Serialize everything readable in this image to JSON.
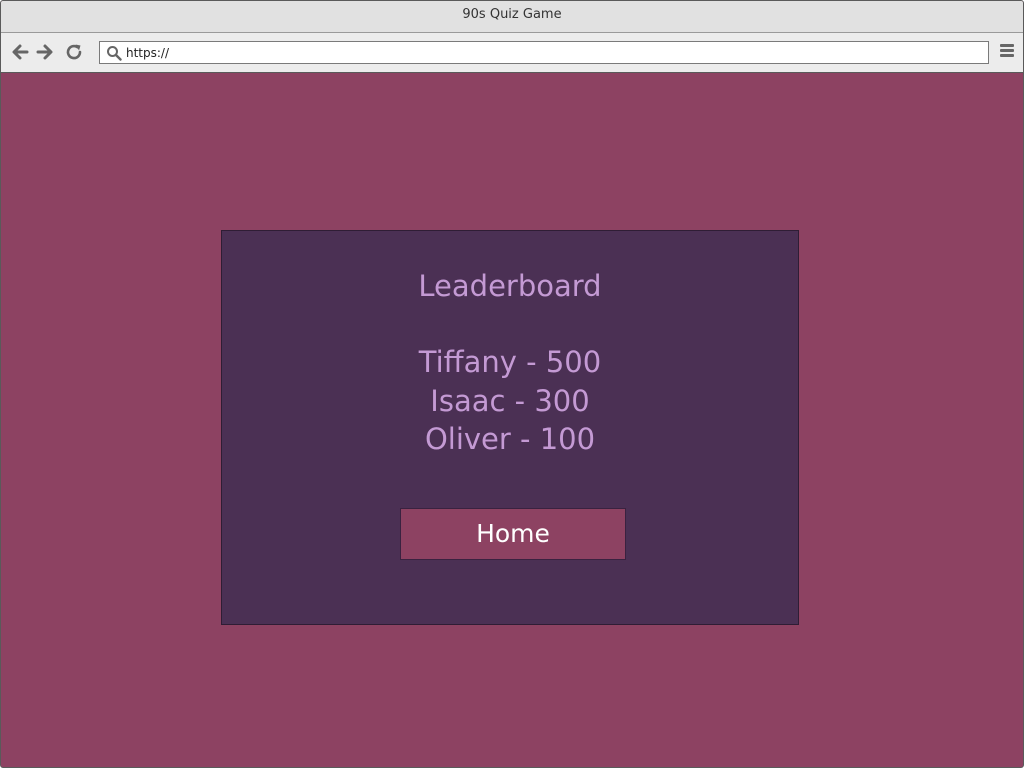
{
  "window": {
    "title": "90s Quiz Game"
  },
  "navbar": {
    "url_value": "https://",
    "icons": [
      "back-arrow-icon",
      "forward-arrow-icon",
      "reload-icon",
      "search-icon",
      "hamburger-menu-icon"
    ]
  },
  "leaderboard": {
    "title": "Leaderboard",
    "entries": [
      {
        "text": "Tiffany - 500"
      },
      {
        "text": "Isaac - 300"
      },
      {
        "text": "Oliver - 100"
      }
    ],
    "home_label": "Home"
  },
  "colors": {
    "page_background": "#8d4262",
    "panel_background": "#4b3054",
    "panel_text": "#c49ad4",
    "button_background": "#8d4262",
    "button_text": "#ffffff",
    "chrome_background": "#e1e1e1"
  }
}
